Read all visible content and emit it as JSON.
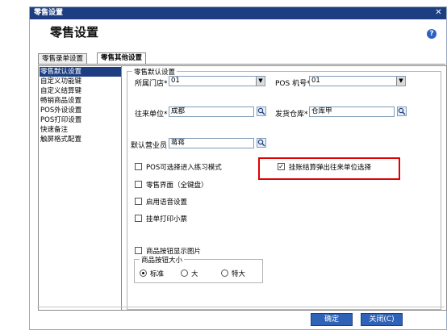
{
  "window": {
    "title": "零售设置",
    "close_glyph": "✕"
  },
  "header": {
    "title": "零售设置",
    "help_glyph": "?"
  },
  "tabs": [
    {
      "label": "零售录单设置"
    },
    {
      "label": "零售其他设置"
    }
  ],
  "nav": {
    "items": [
      {
        "label": "零售默认设置"
      },
      {
        "label": "自定义功能键"
      },
      {
        "label": "自定义结算键"
      },
      {
        "label": "畅销商品设置"
      },
      {
        "label": "POS外设设置"
      },
      {
        "label": "POS打印设置"
      },
      {
        "label": "快速备注"
      },
      {
        "label": "触屏格式配置"
      }
    ]
  },
  "group": {
    "title": "零售默认设置"
  },
  "form": {
    "store": {
      "label": "所属门店*",
      "value": "01"
    },
    "pos": {
      "label": "POS 机号*",
      "value": "01"
    },
    "unit": {
      "label": "往来单位*",
      "value": "成都"
    },
    "warehouse": {
      "label": "发货仓库*",
      "value": "仓库甲"
    },
    "salesperson": {
      "label": "默认营业员",
      "value": "蒋蒋"
    }
  },
  "options": {
    "practice": {
      "label": "POS可选择进入练习模式",
      "checked": false
    },
    "fullkb": {
      "label": "零售界面（全键盘）",
      "checked": false
    },
    "voice": {
      "label": "启用语音设置",
      "checked": false
    },
    "print_hang": {
      "label": "挂单打印小票",
      "checked": false
    },
    "popup_unit": {
      "label": "挂账结算弹出往来单位选择",
      "checked": true,
      "check_glyph": "✓"
    },
    "show_image": {
      "label": "商品按钮显示图片",
      "checked": false
    }
  },
  "button_size": {
    "title": "商品按钮大小",
    "options": [
      {
        "label": "标准",
        "selected": true
      },
      {
        "label": "大",
        "selected": false
      },
      {
        "label": "特大",
        "selected": false
      }
    ]
  },
  "footer": {
    "ok_label": "确定",
    "close_label": "关闭(C)"
  },
  "colors": {
    "accent": "#1d3f82",
    "highlight": "#e00000",
    "button": "#2f63b8"
  }
}
